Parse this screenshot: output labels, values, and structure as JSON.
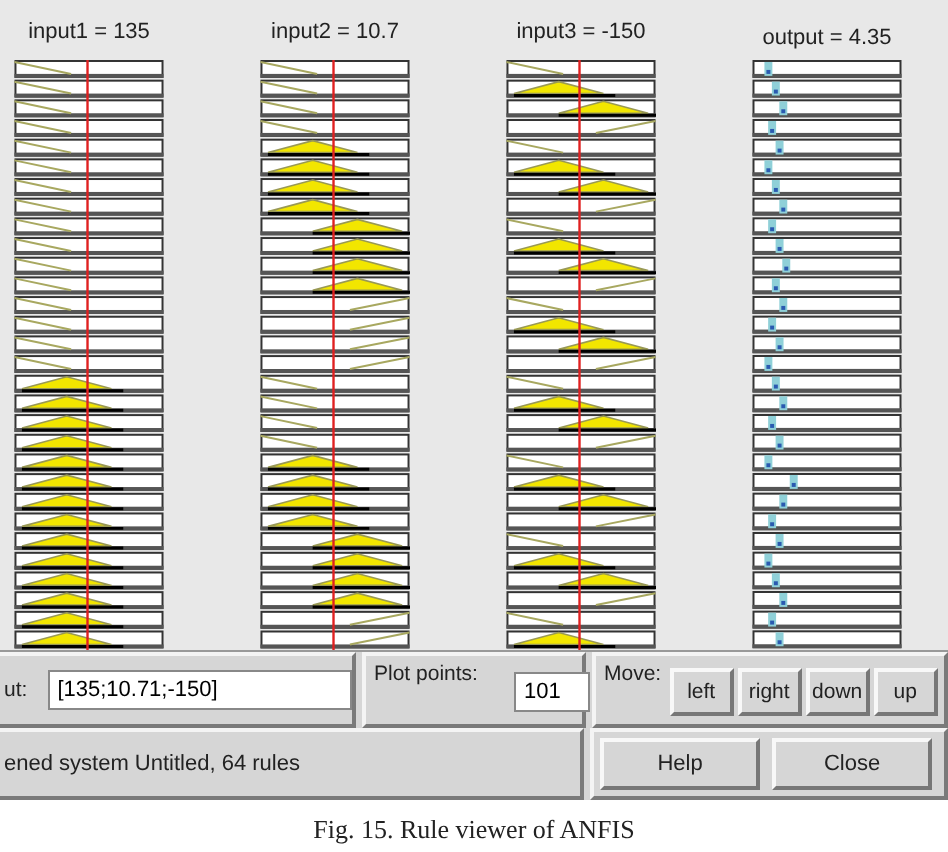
{
  "variables": [
    {
      "label": "input1 = 135",
      "kind": "input"
    },
    {
      "label": "input2 = 10.7",
      "kind": "input"
    },
    {
      "label": "input3 = -150",
      "kind": "input"
    },
    {
      "label": "output = 4.35",
      "kind": "output"
    }
  ],
  "input": {
    "label": "ut:",
    "value": "[135;10.71;-150]"
  },
  "plot_points": {
    "label": "Plot points:",
    "value": "101"
  },
  "move": {
    "label": "Move:",
    "buttons": [
      "left",
      "right",
      "down",
      "up"
    ]
  },
  "status": "ened system Untitled, 64 rules",
  "buttons": [
    "Help",
    "Close"
  ],
  "caption": "Fig. 15. Rule viewer of ANFIS"
}
